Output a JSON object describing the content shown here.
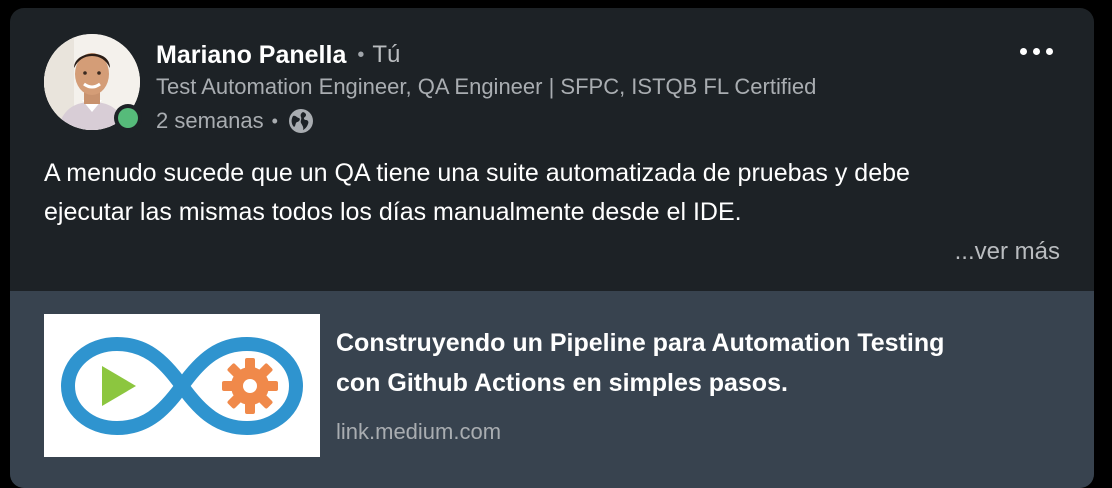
{
  "post": {
    "author": {
      "name": "Mariano Panella",
      "separator": "•",
      "degree": "Tú",
      "headline": "Test Automation Engineer, QA Engineer | SFPC, ISTQB FL Certified",
      "online": true
    },
    "meta": {
      "time": "2 semanas",
      "separator": "•",
      "visibility_icon": "globe-icon"
    },
    "more_menu_icon": "ellipsis-horizontal-icon",
    "body_line_1": "A menudo sucede que un QA tiene una suite automatizada de pruebas y debe",
    "body_line_2": "ejecutar las mismas todos los días manualmente desde el IDE.",
    "see_more": "...ver más"
  },
  "link_preview": {
    "title_line_1": "Construyendo un Pipeline para Automation Testing",
    "title_line_2": "con Github Actions en simples pasos.",
    "source": "link.medium.com",
    "thumbnail_icon": "infinity-pipeline-logo"
  },
  "colors": {
    "card_bg": "#1d2226",
    "link_card_bg": "#38434f",
    "presence_green": "#56bb7a",
    "logo_blue": "#2f94cf",
    "logo_green": "#8cc63f",
    "logo_orange": "#f0894a"
  }
}
